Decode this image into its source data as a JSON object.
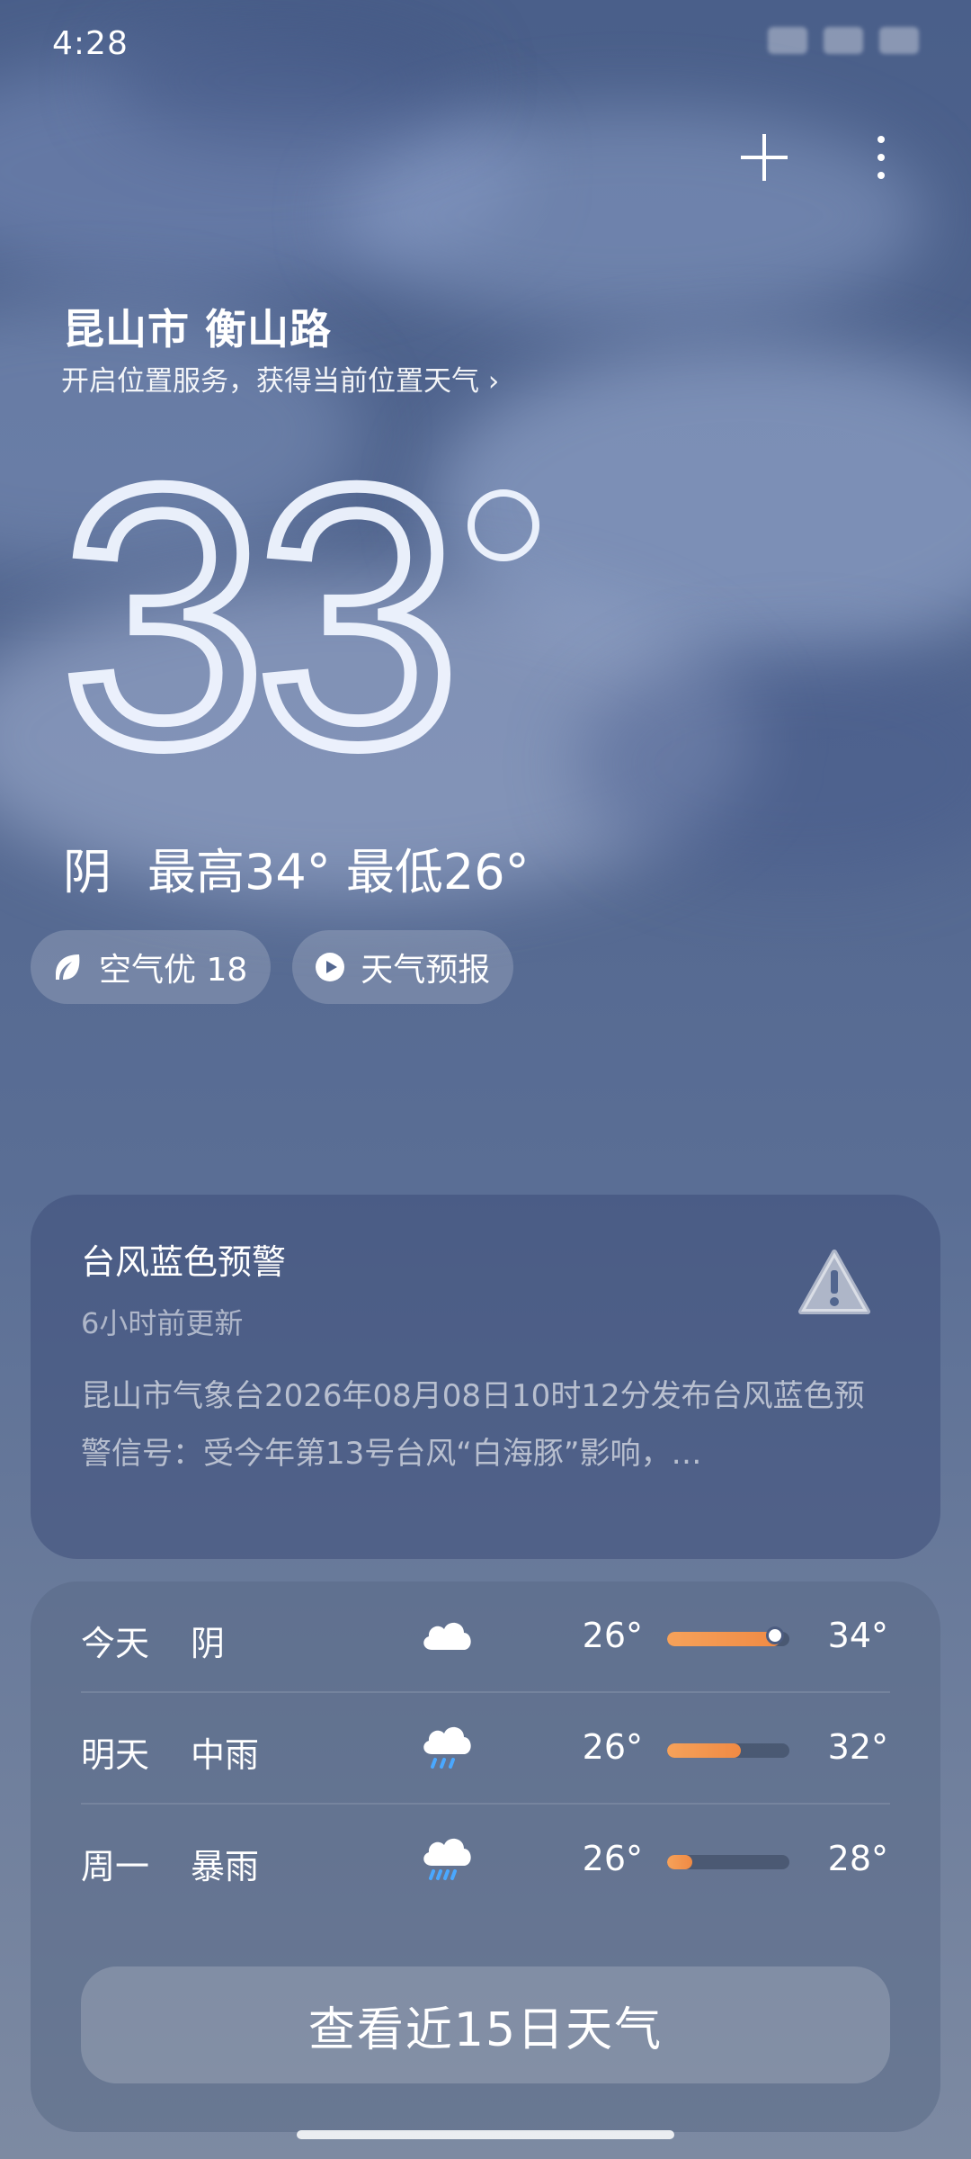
{
  "status_bar": {
    "time": "4:28"
  },
  "header": {
    "add_icon": "plus-icon",
    "more_icon": "more-vertical-icon"
  },
  "location": {
    "name": "昆山市 衡山路",
    "hint": "开启位置服务，获得当前位置天气 ›"
  },
  "current": {
    "temperature": "33",
    "condition": "阴",
    "high_low": "最高34° 最低26°"
  },
  "chips": [
    {
      "icon": "leaf-icon",
      "label": "空气优 18"
    },
    {
      "icon": "play-icon",
      "label": "天气预报"
    }
  ],
  "alert": {
    "title": "台风蓝色预警",
    "updated": "6小时前更新",
    "body": "昆山市气象台2026年08月08日10时12分发布台风蓝色预警信号：受今年第13号台风“白海豚”影响，…",
    "icon": "warning-icon"
  },
  "forecast": {
    "rows": [
      {
        "day": "今天",
        "condition": "阴",
        "icon": "cloud-icon",
        "low": "26°",
        "high": "34°"
      },
      {
        "day": "明天",
        "condition": "中雨",
        "icon": "rain-icon",
        "low": "26°",
        "high": "32°"
      },
      {
        "day": "周一",
        "condition": "暴雨",
        "icon": "rain-icon",
        "low": "26°",
        "high": "28°"
      }
    ],
    "button_label": "查看近15日天气"
  },
  "colors": {
    "accent_bar": "#f08a44",
    "background_top": "#4a5f8a",
    "background_bottom": "#7d8aa2"
  }
}
